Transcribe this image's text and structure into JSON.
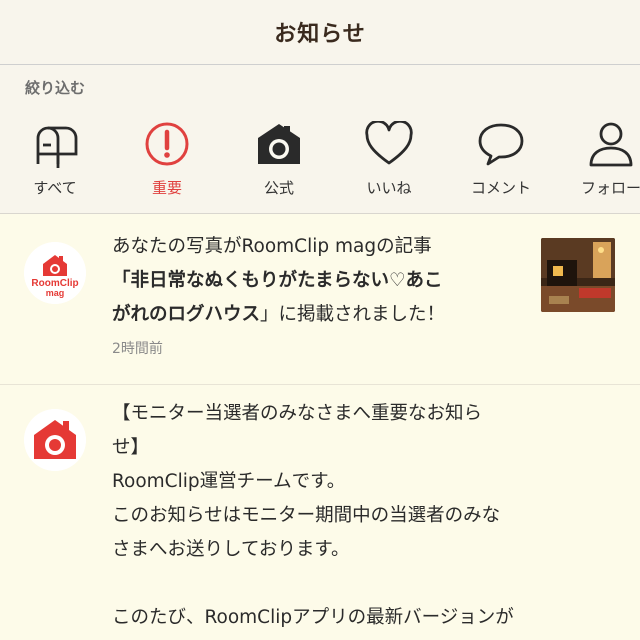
{
  "header": {
    "title": "お知らせ"
  },
  "filter": {
    "label": "絞り込む",
    "items": [
      {
        "label": "すべて",
        "icon": "mailbox-icon"
      },
      {
        "label": "重要",
        "icon": "exclamation-icon",
        "active": true
      },
      {
        "label": "公式",
        "icon": "house-camera-icon"
      },
      {
        "label": "いいね",
        "icon": "heart-icon"
      },
      {
        "label": "コメント",
        "icon": "speech-bubble-icon"
      },
      {
        "label": "フォロー",
        "icon": "person-icon"
      }
    ]
  },
  "notifications": [
    {
      "avatar": "roomclip-mag-logo",
      "line1": "あなたの写真がRoomClip magの記事",
      "bold1": "「非日常なぬくもりがたまらない♡あこ",
      "bold2": "がれのログハウス",
      "tail": "」に掲載されました！",
      "time": "2時間前",
      "thumbnail": "log-house-photo"
    },
    {
      "avatar": "roomclip-logo",
      "lines": [
        "【モニター当選者のみなさまへ重要なお知ら",
        "せ】",
        "RoomClip運営チームです。",
        "このお知らせはモニター期間中の当選者のみな",
        "さまへお送りしております。",
        "",
        "このたび、RoomClipアプリの最新バージョンが"
      ]
    }
  ],
  "colors": {
    "accent": "#e0413f",
    "brand": "#e53935",
    "dark": "#3a2a1e"
  }
}
